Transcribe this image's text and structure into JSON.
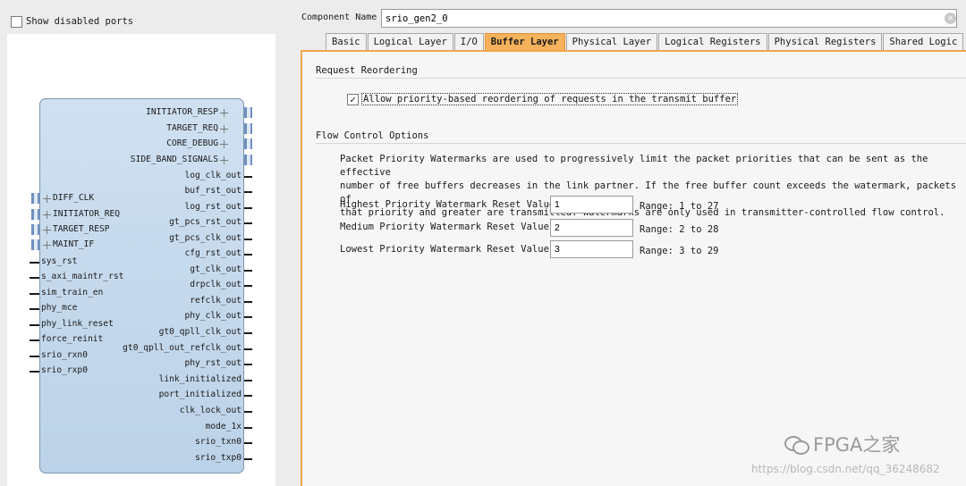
{
  "left": {
    "show_disabled_label": "Show disabled ports",
    "right_bus_ports": [
      "INITIATOR_RESP",
      "TARGET_REQ",
      "CORE_DEBUG",
      "SIDE_BAND_SIGNALS"
    ],
    "right_ports": [
      "log_clk_out",
      "buf_rst_out",
      "log_rst_out",
      "gt_pcs_rst_out",
      "gt_pcs_clk_out",
      "cfg_rst_out",
      "gt_clk_out",
      "drpclk_out",
      "refclk_out",
      "phy_clk_out",
      "gt0_qpll_clk_out",
      "gt0_qpll_out_refclk_out",
      "phy_rst_out",
      "link_initialized",
      "port_initialized",
      "clk_lock_out",
      "mode_1x",
      "srio_txn0",
      "srio_txp0"
    ],
    "left_bus_ports": [
      "DIFF_CLK",
      "INITIATOR_REQ",
      "TARGET_RESP",
      "MAINT_IF"
    ],
    "left_ports": [
      "sys_rst",
      "s_axi_maintr_rst",
      "sim_train_en",
      "phy_mce",
      "phy_link_reset",
      "force_reinit",
      "srio_rxn0",
      "srio_rxp0"
    ]
  },
  "right": {
    "component_label": "Component Name",
    "component_value": "srio_gen2_0",
    "tabs": [
      "Basic",
      "Logical Layer",
      "I/O",
      "Buffer Layer",
      "Physical Layer",
      "Logical Registers",
      "Physical Registers",
      "Shared Logic"
    ],
    "active_tab": "Buffer Layer",
    "request_reordering_title": "Request Reordering",
    "reorder_label": "Allow priority-based reordering of requests in the transmit buffer",
    "reorder_checked": true,
    "flow_control_title": "Flow Control Options",
    "description": [
      "Packet Priority Watermarks are used to progressively limit the packet priorities that can be sent as the effective",
      "number of free buffers decreases in the link partner. If the free buffer count exceeds the watermark, packets of",
      "that priority and greater are transmitted. Watermarks are only used in transmitter-controlled flow control."
    ],
    "watermarks": [
      {
        "label": "Highest Priority Watermark Reset Value",
        "value": "1",
        "range": "Range: 1 to 27"
      },
      {
        "label": "Medium Priority Watermark Reset Value",
        "value": "2",
        "range": "Range: 2 to 28"
      },
      {
        "label": "Lowest Priority Watermark Reset Value",
        "value": "3",
        "range": "Range: 3 to 29"
      }
    ]
  },
  "watermark": {
    "brand": "FPGA之家",
    "url": "https://blog.csdn.net/qq_36248682"
  }
}
